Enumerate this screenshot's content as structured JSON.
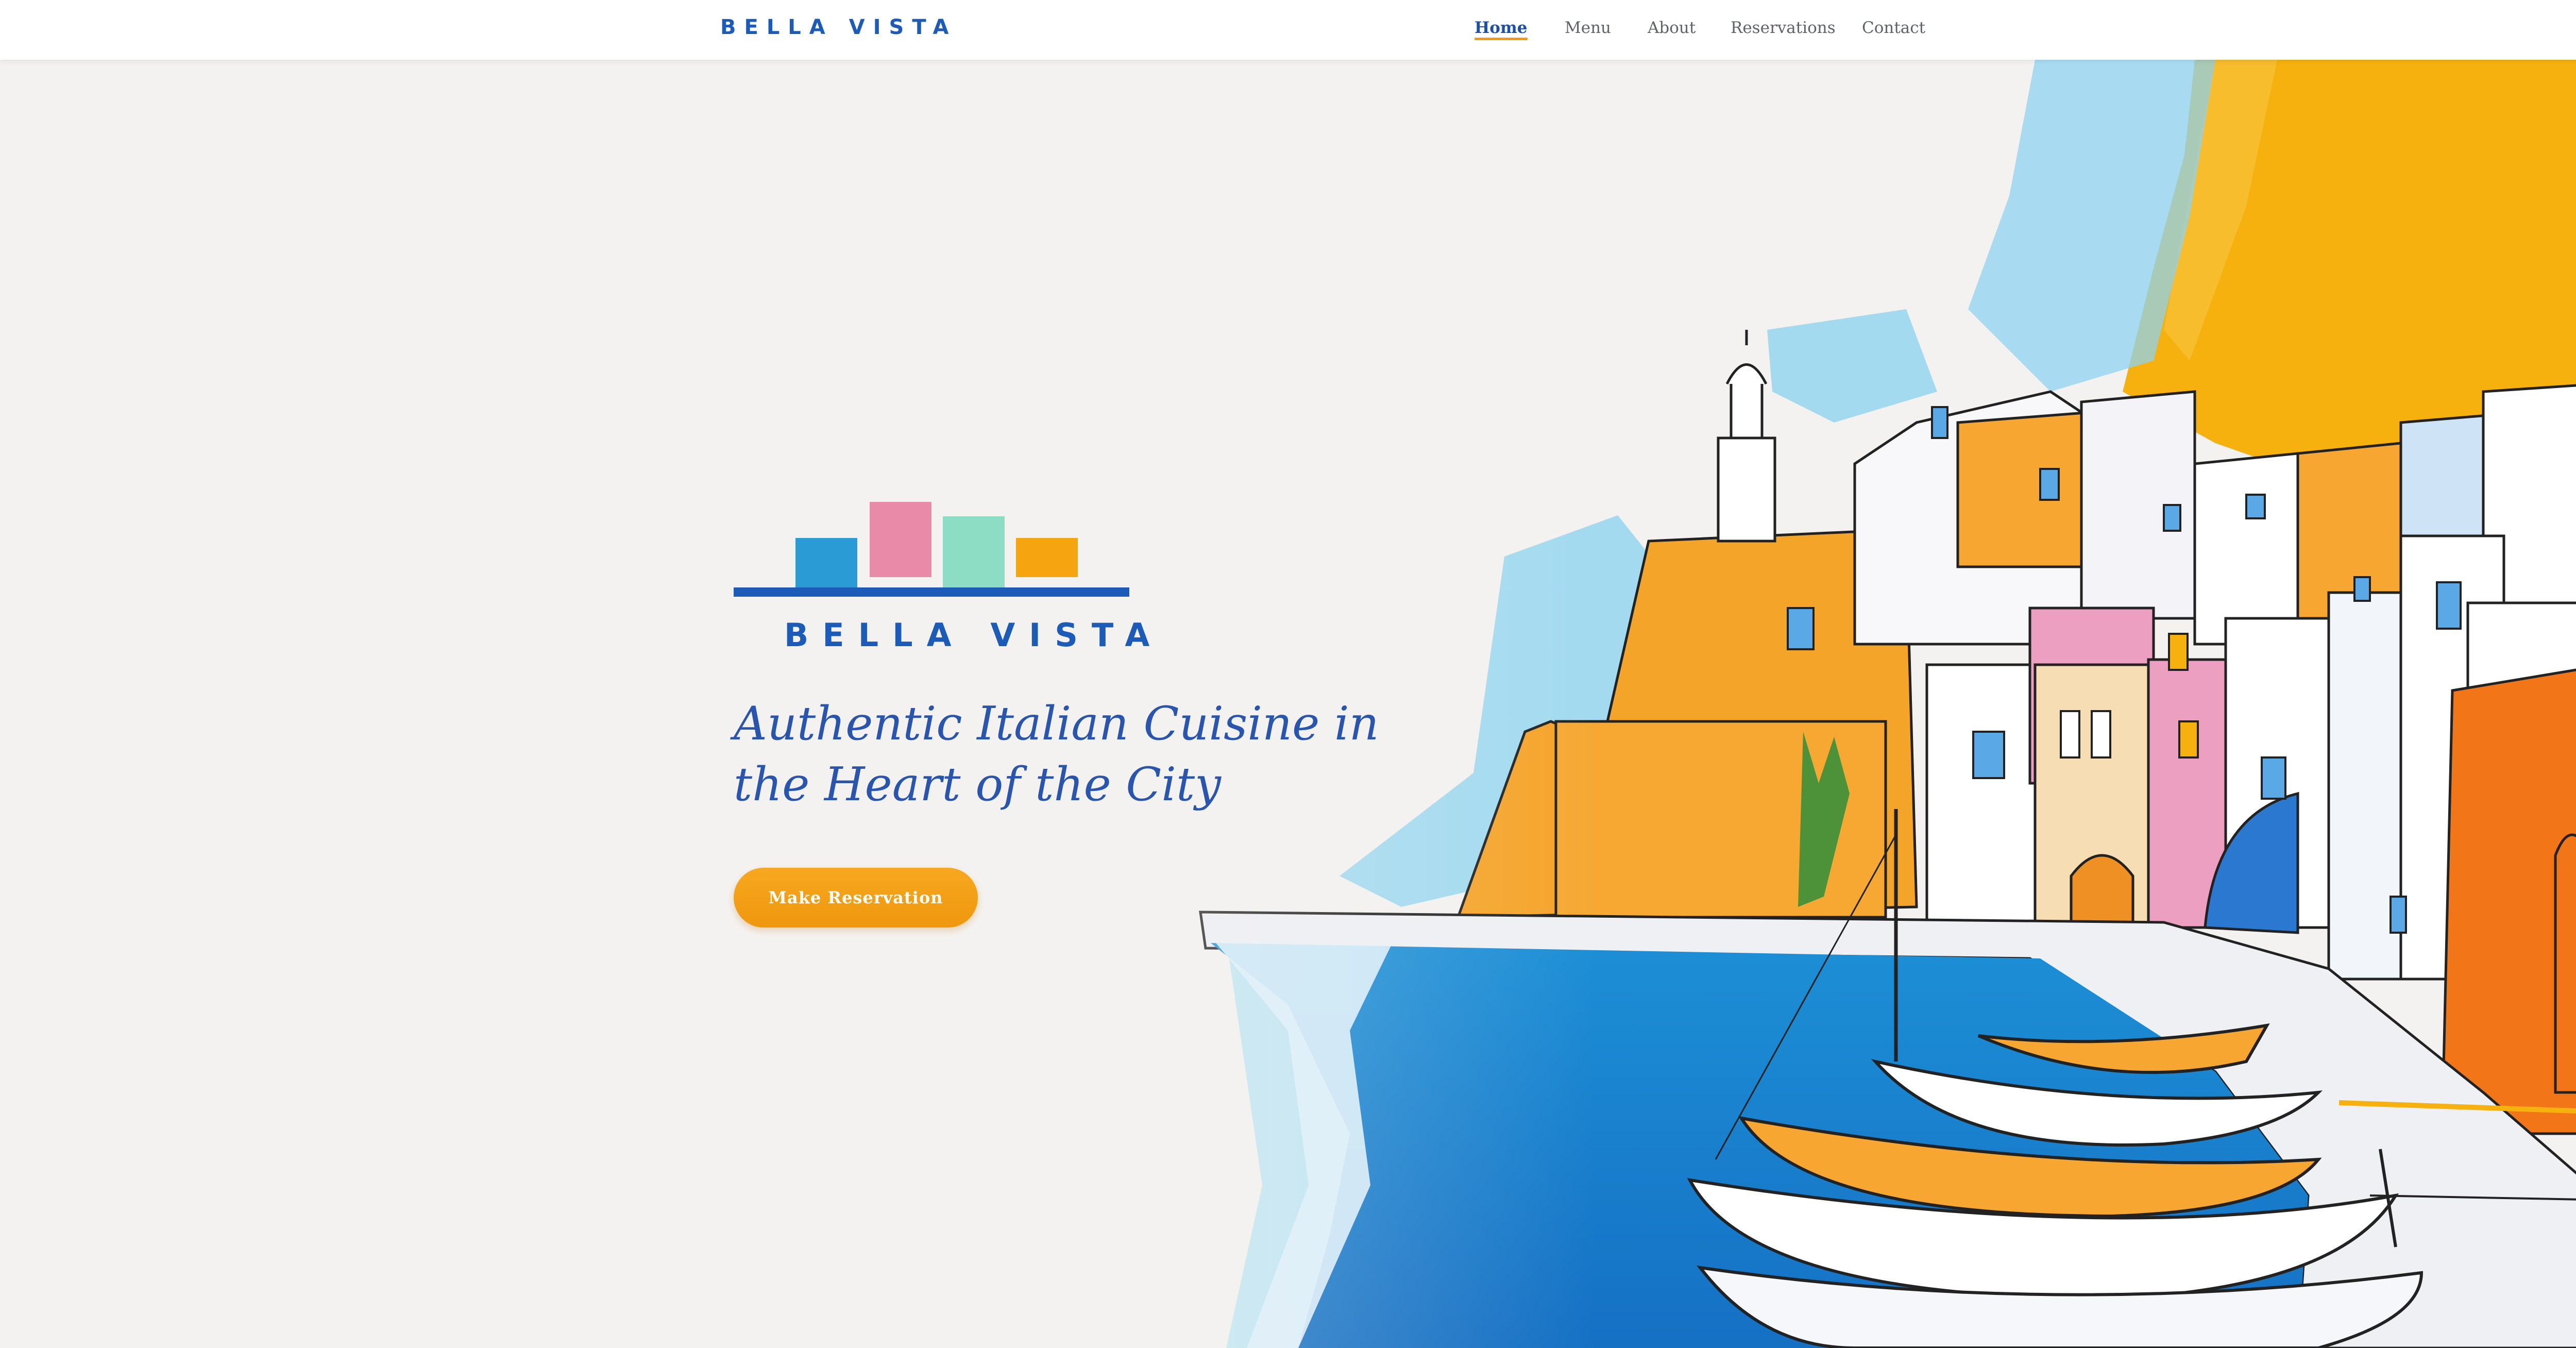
{
  "nav": {
    "brand": "BELLA VISTA",
    "links": [
      {
        "label": "Home",
        "active": true
      },
      {
        "label": "Menu",
        "active": false
      },
      {
        "label": "About",
        "active": false
      },
      {
        "label": "Reservations",
        "active": false
      },
      {
        "label": "Contact",
        "active": false
      }
    ]
  },
  "hero": {
    "logo_wordmark": "BELLA VISTA",
    "title_line1": "Authentic Italian Cuisine in",
    "title_line2": "the Heart of the City",
    "cta_label": "Make Reservation"
  },
  "colors": {
    "brand_blue": "#1c5bb8",
    "accent_orange": "#f29a18",
    "logo_block_blue": "#2b9bd6",
    "logo_block_pink": "#e98aa8",
    "logo_block_mint": "#8ddcc4",
    "logo_block_orange": "#f6a40f"
  }
}
